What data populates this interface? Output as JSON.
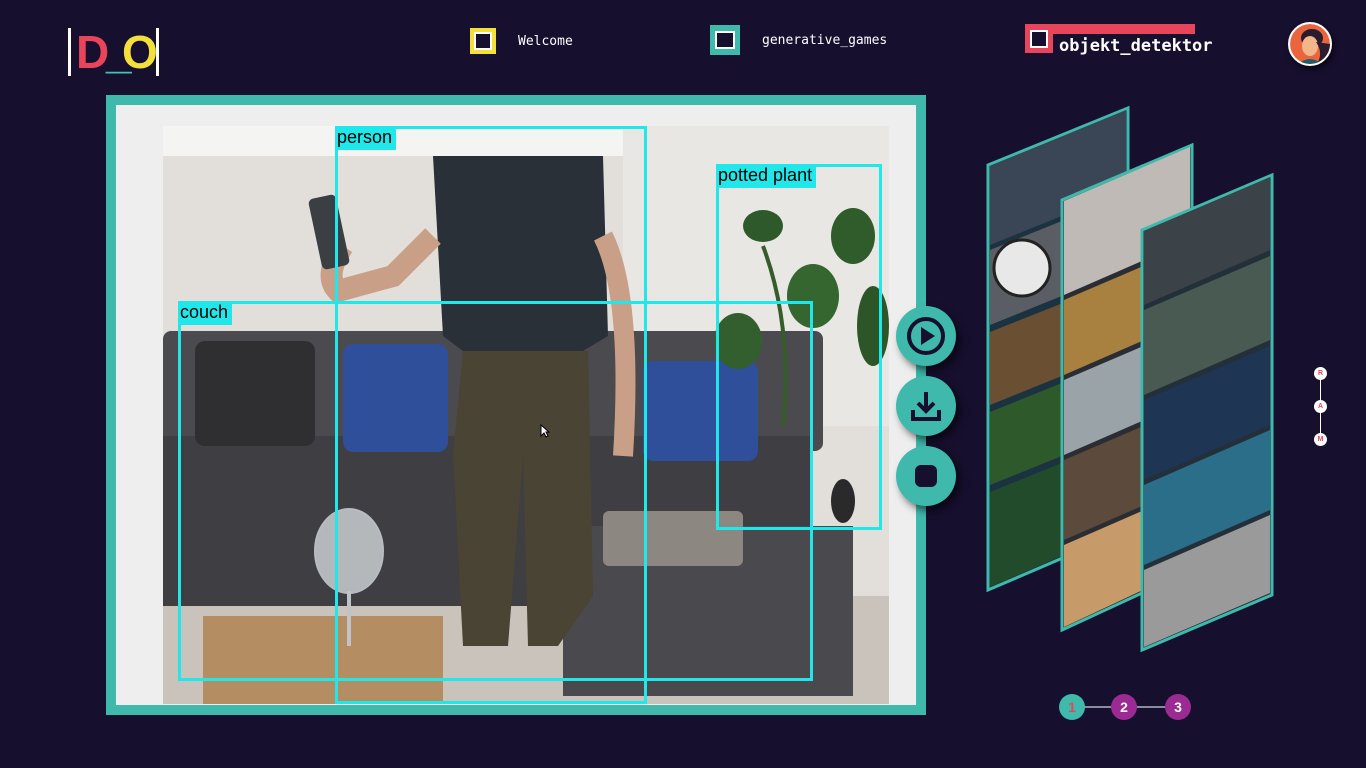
{
  "logo": {
    "letters": [
      "D",
      "_",
      "O"
    ]
  },
  "tabs": [
    {
      "label": "Welcome",
      "icon": "window-icon",
      "color": "#f3e03b"
    },
    {
      "label": "generative_games",
      "icon": "window-icon",
      "color": "#3fb9ac"
    },
    {
      "label": "objekt_detektor",
      "icon": "window-icon",
      "color": "#e8455a",
      "active": true
    }
  ],
  "detections": [
    {
      "label": "person"
    },
    {
      "label": "potted plant"
    },
    {
      "label": "couch"
    }
  ],
  "controls": {
    "play": "play-icon",
    "download": "download-icon",
    "stop": "stop-icon"
  },
  "side_indicator": [
    "R",
    "A",
    "M"
  ],
  "pager": [
    "1",
    "2",
    "3"
  ],
  "colors": {
    "background": "#160f2e",
    "teal": "#3fb9ac",
    "red": "#e8455a",
    "yellow": "#f3e03b",
    "purple": "#9c2a93",
    "detection_box": "#20e8ea"
  }
}
